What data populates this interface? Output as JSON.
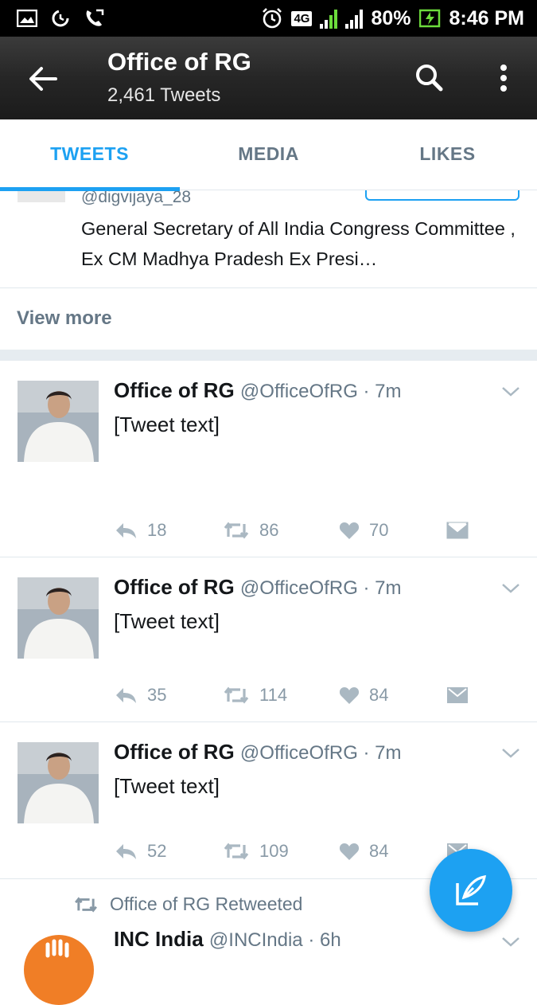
{
  "status_bar": {
    "network": "4G",
    "battery": "80%",
    "time": "8:46 PM"
  },
  "header": {
    "title": "Office of RG",
    "subtitle": "2,461 Tweets",
    "back_icon": "back-arrow-icon",
    "search_icon": "search-icon",
    "more_icon": "more-vertical-icon"
  },
  "tabs": [
    {
      "label": "TWEETS",
      "active": true
    },
    {
      "label": "MEDIA",
      "active": false
    },
    {
      "label": "LIKES",
      "active": false
    }
  ],
  "suggestion": {
    "handle": "@digvijaya_28",
    "bio": "General Secretary of All India Congress Committee , Ex CM Madhya Pradesh Ex Presi…"
  },
  "view_more": "View more",
  "tweets": [
    {
      "name": "Office of RG",
      "handle": "@OfficeOfRG · 7m",
      "text": "[Tweet text]",
      "replies": "18",
      "retweets": "86",
      "likes": "70"
    },
    {
      "name": "Office of RG",
      "handle": "@OfficeOfRG · 7m",
      "text": "[Tweet text]",
      "replies": "35",
      "retweets": "114",
      "likes": "84"
    },
    {
      "name": "Office of RG",
      "handle": "@OfficeOfRG · 7m",
      "text": "[Tweet text]",
      "replies": "52",
      "retweets": "109",
      "likes": "84"
    }
  ],
  "retweet_item": {
    "context": "Office of RG Retweeted",
    "name": "INC India",
    "handle": "@INCIndia · 6h"
  },
  "colors": {
    "accent": "#1da1f2",
    "muted": "#657786",
    "icon_gray": "#8899a6"
  }
}
